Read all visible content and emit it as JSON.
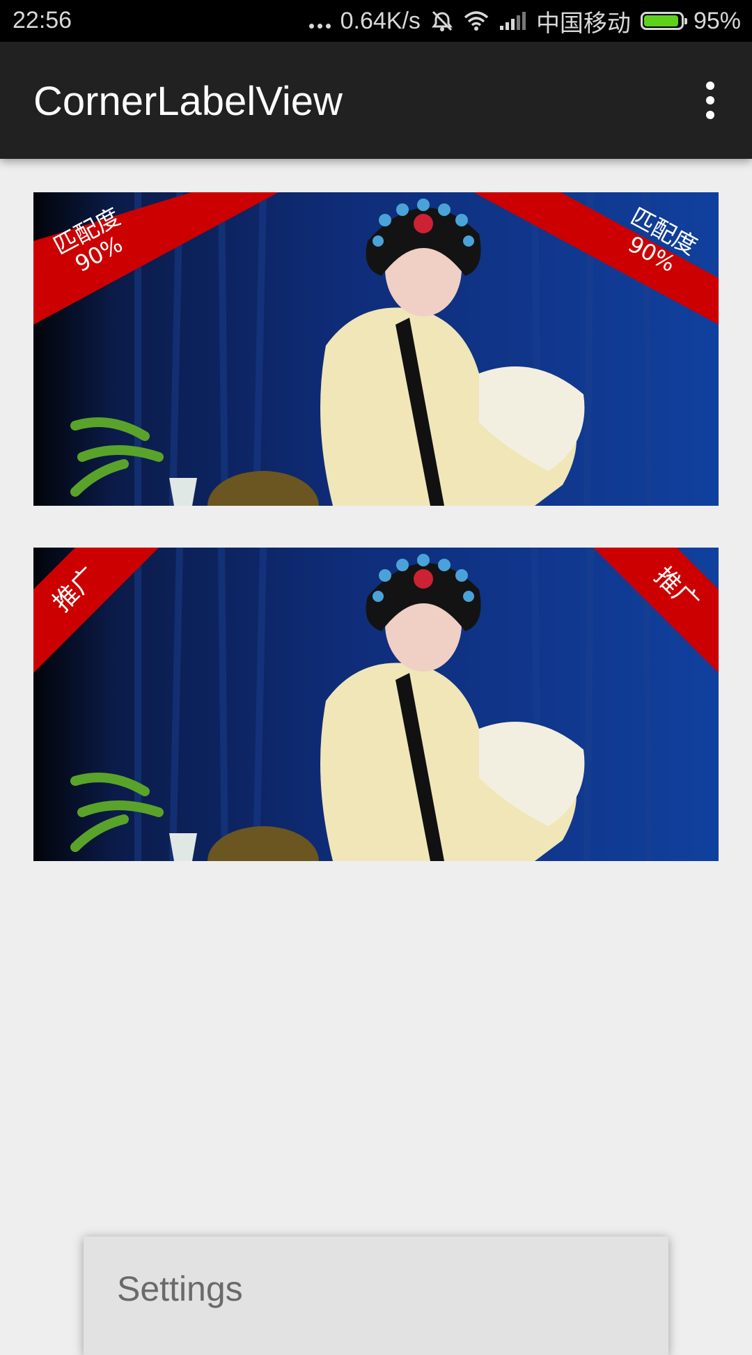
{
  "status_bar": {
    "time": "22:56",
    "network_speed": "0.64K/s",
    "carrier": "中国移动",
    "battery": "95%",
    "battery_level": 0.95,
    "battery_color": "#5ed11c",
    "icons": [
      "more-dots-icon",
      "alarm-off-icon",
      "wifi-icon",
      "signal-icon",
      "battery-icon"
    ]
  },
  "app_bar": {
    "title": "CornerLabelView",
    "menu_icon": "more-vert-icon"
  },
  "cards": [
    {
      "label_left": [
        "匹配度",
        "90%"
      ],
      "label_right": [
        "匹配度",
        "90%"
      ],
      "label_color": "#cc0000"
    },
    {
      "label_left": [
        "推广"
      ],
      "label_right": [
        "推广"
      ],
      "label_color": "#cc0000"
    }
  ],
  "popup_menu": {
    "items": [
      "Settings"
    ]
  }
}
